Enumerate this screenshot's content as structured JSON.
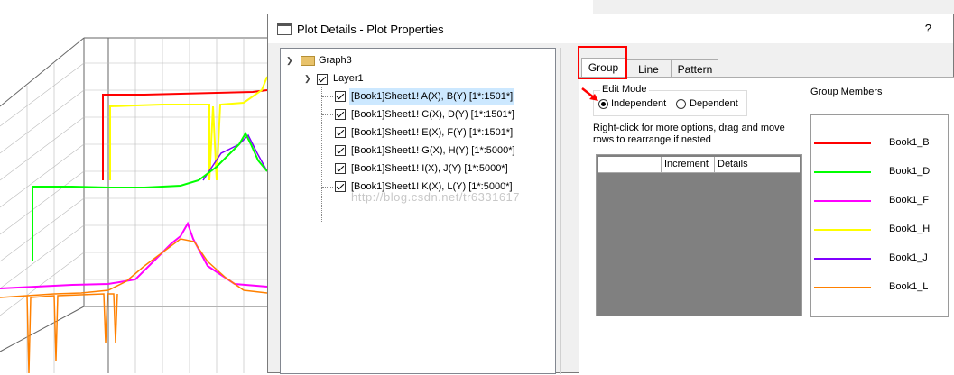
{
  "window": {
    "title": "Plot Details - Plot Properties",
    "help_label": "?"
  },
  "tree": {
    "root": "Graph3",
    "layer": "Layer1",
    "items": [
      "[Book1]Sheet1! A(X), B(Y) [1*:1501*]",
      "[Book1]Sheet1! C(X), D(Y) [1*:1501*]",
      "[Book1]Sheet1! E(X), F(Y) [1*:1501*]",
      "[Book1]Sheet1! G(X), H(Y) [1*:5000*]",
      "[Book1]Sheet1! I(X), J(Y) [1*:5000*]",
      "[Book1]Sheet1! K(X), L(Y) [1*:5000*]"
    ],
    "selected_index": 0
  },
  "tabs": [
    "Group",
    "Line",
    "Pattern"
  ],
  "active_tab": "Group",
  "edit_mode": {
    "label": "Edit Mode",
    "options": [
      "Independent",
      "Dependent"
    ],
    "selected": "Independent"
  },
  "hint": {
    "line1": "Right-click for more options, drag and move",
    "line2": "rows to  rearrange if nested"
  },
  "grid": {
    "columns": [
      "",
      "Increment",
      "Details"
    ]
  },
  "group_members": {
    "label": "Group Members",
    "items": [
      {
        "name": "Book1_B",
        "color": "#ff0000"
      },
      {
        "name": "Book1_D",
        "color": "#00ff00"
      },
      {
        "name": "Book1_F",
        "color": "#ff00ff"
      },
      {
        "name": "Book1_H",
        "color": "#ffff00"
      },
      {
        "name": "Book1_J",
        "color": "#8000ff"
      },
      {
        "name": "Book1_L",
        "color": "#ff8000"
      }
    ]
  },
  "watermark": "http://blog.csdn.net/tr6331617"
}
